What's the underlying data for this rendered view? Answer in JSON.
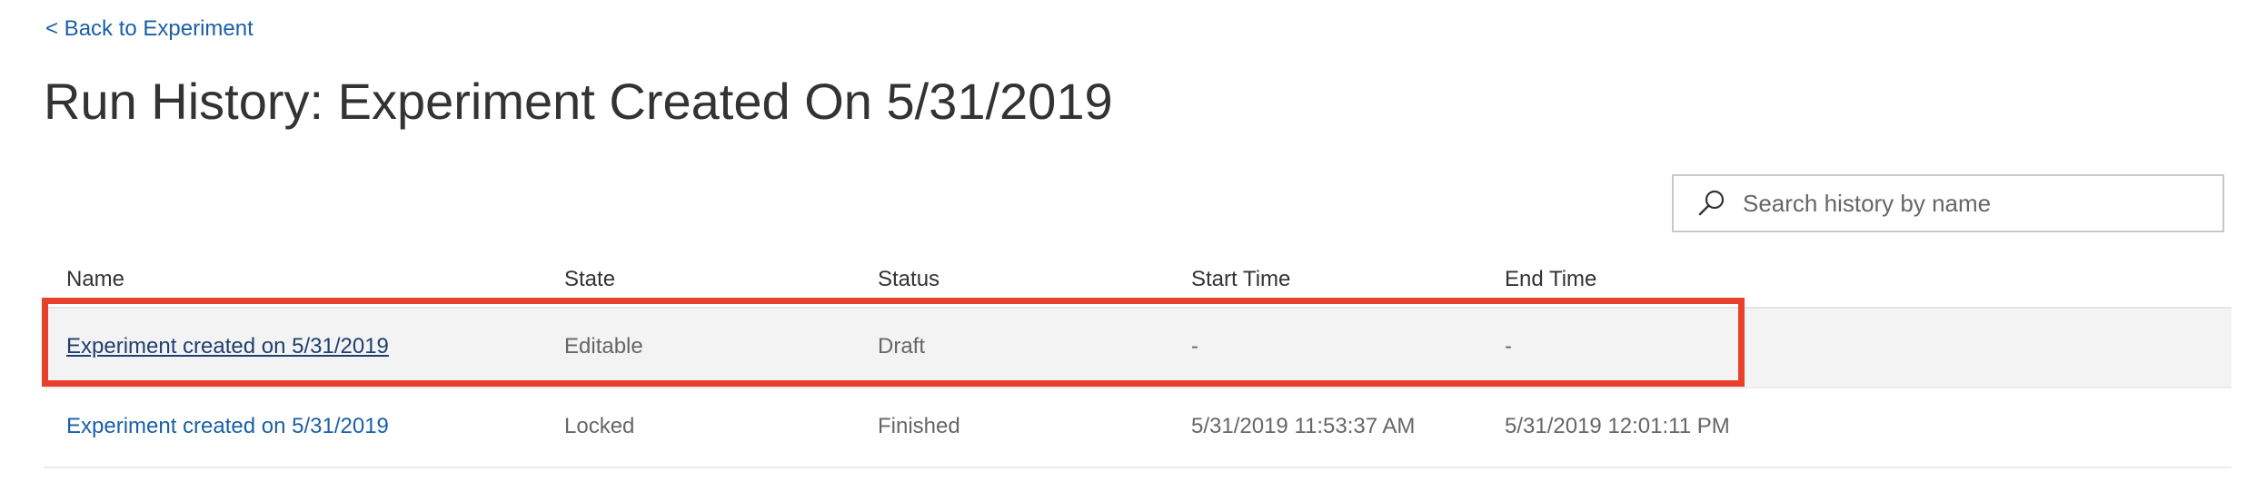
{
  "nav": {
    "back_label": "< Back to Experiment"
  },
  "page": {
    "title": "Run History: Experiment Created On 5/31/2019"
  },
  "search": {
    "placeholder": "Search history by name",
    "value": ""
  },
  "table": {
    "columns": [
      "Name",
      "State",
      "Status",
      "Start Time",
      "End Time"
    ],
    "rows": [
      {
        "name": "Experiment created on 5/31/2019",
        "state": "Editable",
        "status": "Draft",
        "start_time": "-",
        "end_time": "-",
        "selected": true
      },
      {
        "name": "Experiment created on 5/31/2019",
        "state": "Locked",
        "status": "Finished",
        "start_time": "5/31/2019 11:53:37 AM",
        "end_time": "5/31/2019 12:01:11 PM",
        "selected": false
      }
    ]
  },
  "colors": {
    "link": "#1a5fa8",
    "highlight_border": "#e8402a",
    "selected_row_bg": "#f3f3f3"
  },
  "icons": {
    "search": "search-icon"
  }
}
